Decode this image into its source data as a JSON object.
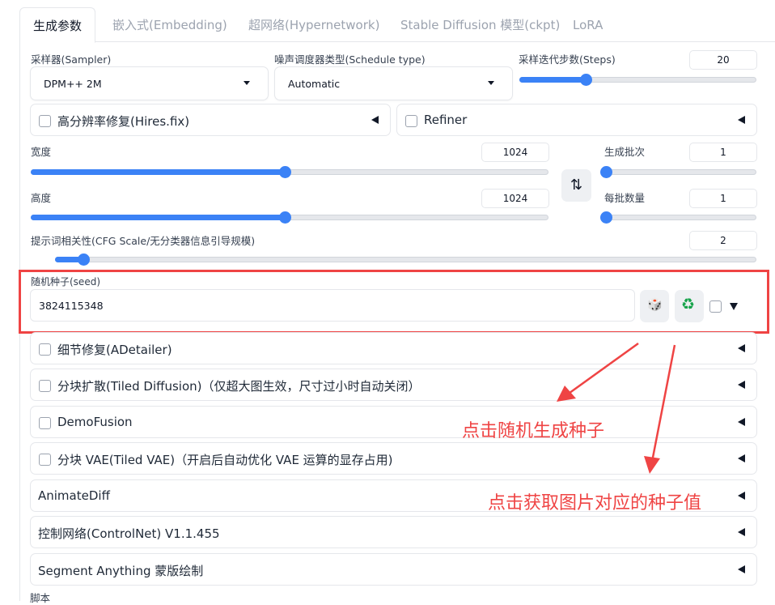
{
  "tabs": [
    "生成参数",
    "嵌入式(Embedding)",
    "超网络(Hypernetwork)",
    "Stable Diffusion 模型(ckpt)",
    "LoRA"
  ],
  "sampler": {
    "label": "采样器(Sampler)",
    "value": "DPM++ 2M"
  },
  "schedule": {
    "label": "噪声调度器类型(Schedule type)",
    "value": "Automatic"
  },
  "steps": {
    "label": "采样迭代步数(Steps)",
    "value": "20",
    "level": 0.28
  },
  "hires": {
    "label": "高分辨率修复(Hires.fix)"
  },
  "refiner": {
    "label": "Refiner"
  },
  "width": {
    "label": "宽度",
    "value": "1024",
    "level": 0.49
  },
  "height": {
    "label": "高度",
    "value": "1024",
    "level": 0.49
  },
  "batch_count": {
    "label": "生成批次",
    "value": "1",
    "level": 0.0
  },
  "batch_size": {
    "label": "每批数量",
    "value": "1",
    "level": 0.0
  },
  "swap_icon": "swap-vertical-icon",
  "cfg": {
    "label": "提示词相关性(CFG Scale/无分类器信息引导规模)",
    "value": "2",
    "level": 0.04
  },
  "seed": {
    "label": "随机种子(seed)",
    "value": "3824115348",
    "dice_icon": "dice-icon",
    "recycle_icon": "recycle-icon",
    "dice_glyph": "🎲",
    "recycle_glyph": "♻"
  },
  "accordions": [
    "细节修复(ADetailer)",
    "分块扩散(Tiled Diffusion)（仅超大图生效，尺寸过小时自动关闭）",
    "DemoFusion",
    "分块 VAE(Tiled VAE)（开启后自动优化 VAE 运算的显存占用)",
    "AnimateDiff",
    "控制网络(ControlNet) V1.1.455",
    "Segment Anything 蒙版绘制"
  ],
  "script_label": "脚本",
  "annotations": {
    "random_seed": "点击随机生成种子",
    "reuse_seed": "点击获取图片对应的种子值"
  },
  "colors": {
    "accent": "#3b82f6",
    "highlight": "#ef4444"
  }
}
